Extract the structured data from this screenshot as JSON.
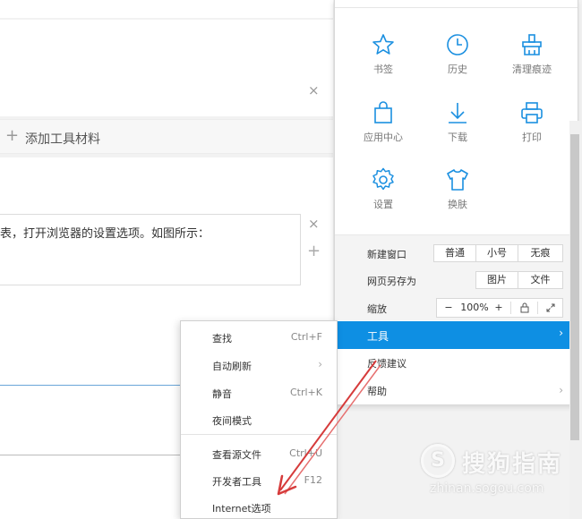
{
  "editor": {
    "add_material_label": "添加工具材料",
    "add_icon": "+",
    "close_icon": "×",
    "step_text": "表，打开浏览器的设置选项。如图所示："
  },
  "menu": {
    "icons": [
      {
        "label": "书签",
        "icon": "star-icon"
      },
      {
        "label": "历史",
        "icon": "clock-icon"
      },
      {
        "label": "清理痕迹",
        "icon": "broom-icon"
      },
      {
        "label": "应用中心",
        "icon": "bag-icon"
      },
      {
        "label": "下载",
        "icon": "download-icon"
      },
      {
        "label": "打印",
        "icon": "printer-icon"
      },
      {
        "label": "设置",
        "icon": "gear-icon"
      },
      {
        "label": "换肤",
        "icon": "shirt-icon"
      }
    ],
    "new_window": {
      "label": "新建窗口",
      "options": [
        "普通",
        "小号",
        "无痕"
      ]
    },
    "save_page": {
      "label": "网页另存为",
      "options": [
        "图片",
        "文件"
      ]
    },
    "zoom": {
      "label": "缩放",
      "minus": "−",
      "value": "100%",
      "plus": "+"
    },
    "tools_label": "工具",
    "feedback_label": "反馈建议",
    "help_label": "帮助",
    "chevron": "›",
    "accent_color": "#0e8fe3"
  },
  "submenu": {
    "items": [
      {
        "label": "查找",
        "shortcut": "Ctrl+F"
      },
      {
        "label": "自动刷新",
        "shortcut": "›"
      },
      {
        "label": "静音",
        "shortcut": "Ctrl+K"
      },
      {
        "label": "夜间模式",
        "shortcut": ""
      },
      {
        "label": "查看源文件",
        "shortcut": "Ctrl+U"
      },
      {
        "label": "开发者工具",
        "shortcut": "F12"
      },
      {
        "label": "Internet选项",
        "shortcut": ""
      }
    ]
  },
  "watermark": {
    "logo": "S",
    "brand": "搜狗指南",
    "url": "zhinan.sogou.com"
  }
}
